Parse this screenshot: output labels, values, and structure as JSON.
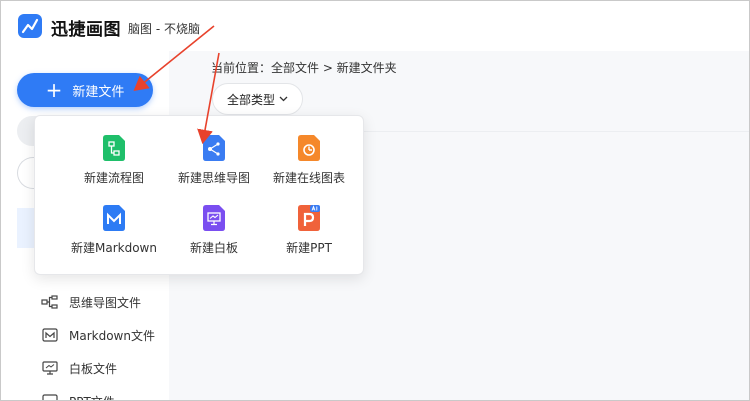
{
  "header": {
    "app_title": "迅捷画图",
    "subtitle": "脑图 - 不烧脑"
  },
  "sidebar": {
    "new_file_label": "新建文件",
    "items": [
      {
        "label": "思维导图文件",
        "icon": "mindmap-icon"
      },
      {
        "label": "Markdown文件",
        "icon": "markdown-icon"
      },
      {
        "label": "白板文件",
        "icon": "whiteboard-icon"
      },
      {
        "label": "PPT文件",
        "icon": "ppt-icon"
      }
    ]
  },
  "main": {
    "breadcrumb": "当前位置：全部文件 > 新建文件夹",
    "filter_label": "全部类型"
  },
  "new_menu": {
    "items": [
      {
        "label": "新建流程图",
        "icon": "flowchart-icon",
        "color": "#1fbf6a"
      },
      {
        "label": "新建思维导图",
        "icon": "mindmap-icon",
        "color": "#3a7cf2"
      },
      {
        "label": "新建在线图表",
        "icon": "chart-icon",
        "color": "#f5882a"
      },
      {
        "label": "新建Markdown",
        "icon": "markdown-icon",
        "color": "#2d7bf4"
      },
      {
        "label": "新建白板",
        "icon": "whiteboard-icon",
        "color": "#7a4ef0"
      },
      {
        "label": "新建PPT",
        "icon": "ppt-icon",
        "color": "#f0623a"
      }
    ]
  },
  "colors": {
    "accent": "#2f7bf5",
    "annotation_arrow": "#e8422c"
  }
}
